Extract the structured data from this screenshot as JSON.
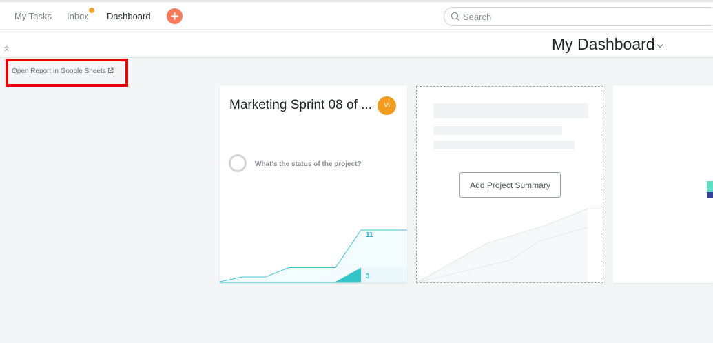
{
  "nav": {
    "my_tasks": "My Tasks",
    "inbox": "Inbox",
    "dashboard": "Dashboard"
  },
  "search": {
    "placeholder": "Search"
  },
  "header": {
    "title": "My Dashboard"
  },
  "report_link": "Open Report in Google Sheets",
  "project_card": {
    "name": "Marketing Sprint 08 of ...",
    "avatar_initials": "Vi",
    "status_prompt": "What's the status of the project?",
    "chart_data": {
      "type": "area",
      "series": [
        {
          "values": [
            0,
            1,
            1,
            3,
            3,
            3,
            11,
            11
          ]
        },
        {
          "values": [
            0,
            0,
            0,
            0,
            0,
            0,
            3,
            3
          ]
        }
      ],
      "data_labels": [
        "11",
        "3"
      ]
    }
  },
  "empty_card": {
    "button_label": "Add Project Summary"
  },
  "colors": {
    "accent": "#fc7a57",
    "inbox_dot": "#f5a623",
    "avatar": "#f29b1d",
    "chart_line": "#3fc4d6",
    "highlight": "#e8000b"
  },
  "icons": [
    "plus-icon",
    "search-icon",
    "collapse-up-icon",
    "chevron-down-icon",
    "external-link-icon"
  ]
}
